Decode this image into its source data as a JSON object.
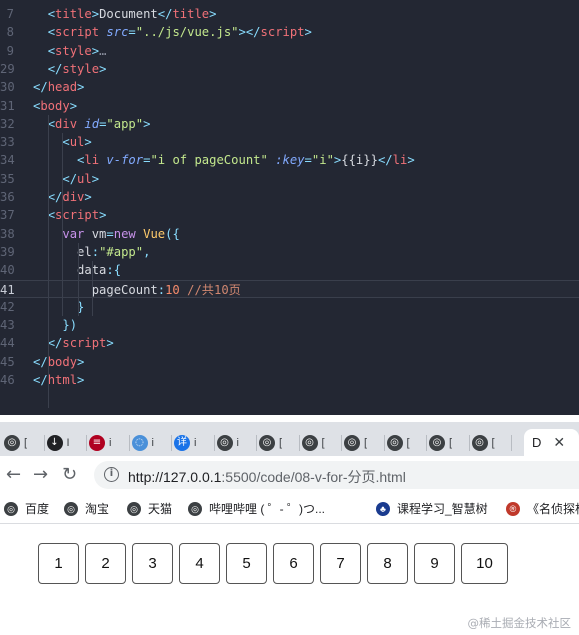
{
  "editor": {
    "lines": [
      {
        "num": "7",
        "html": "  <span class='p'>&lt;</span><span class='t'>title</span><span class='p'>&gt;</span><span class='w'>Document</span><span class='p'>&lt;/</span><span class='t'>title</span><span class='p'>&gt;</span>"
      },
      {
        "num": "8",
        "html": "  <span class='p'>&lt;</span><span class='t'>script</span> <span class='a'>src</span><span class='p'>=</span><span class='s'>\"../js/vue.js\"</span><span class='p'>&gt;&lt;/</span><span class='t'>script</span><span class='p'>&gt;</span>"
      },
      {
        "num": "9",
        "html": "  <span class='p'>&lt;</span><span class='t'>style</span><span class='p'>&gt;</span><span class='g'>…</span>"
      },
      {
        "num": "29",
        "html": "  <span class='p'>&lt;/</span><span class='t'>style</span><span class='p'>&gt;</span>"
      },
      {
        "num": "30",
        "html": "<span class='p'>&lt;/</span><span class='t'>head</span><span class='p'>&gt;</span>"
      },
      {
        "num": "31",
        "html": "<span class='p'>&lt;</span><span class='t'>body</span><span class='p'>&gt;</span>"
      },
      {
        "num": "32",
        "html": "  <span class='p'>&lt;</span><span class='t'>div</span> <span class='a'>id</span><span class='p'>=</span><span class='s'>\"app\"</span><span class='p'>&gt;</span>"
      },
      {
        "num": "33",
        "html": "    <span class='p'>&lt;</span><span class='t'>ul</span><span class='p'>&gt;</span>"
      },
      {
        "num": "34",
        "html": "      <span class='p'>&lt;</span><span class='t'>li</span> <span class='a'>v-for</span><span class='p'>=</span><span class='s'>\"i of pageCount\"</span> <span class='a'>:key</span><span class='p'>=</span><span class='s'>\"i\"</span><span class='p'>&gt;</span><span class='w'>{{i}}</span><span class='p'>&lt;/</span><span class='t'>li</span><span class='p'>&gt;</span>"
      },
      {
        "num": "35",
        "html": "    <span class='p'>&lt;/</span><span class='t'>ul</span><span class='p'>&gt;</span>"
      },
      {
        "num": "36",
        "html": "  <span class='p'>&lt;/</span><span class='t'>div</span><span class='p'>&gt;</span>"
      },
      {
        "num": "37",
        "html": "  <span class='p'>&lt;</span><span class='t'>script</span><span class='p'>&gt;</span>"
      },
      {
        "num": "38",
        "html": "    <span class='k'>var</span> <span class='w'>vm</span><span class='p'>=</span><span class='k'>new</span> <span class='y'>Vue</span><span class='p'>({</span>"
      },
      {
        "num": "39",
        "html": "      <span class='w'>el</span><span class='p'>:</span><span class='s'>\"#app\"</span><span class='p'>,</span>"
      },
      {
        "num": "40",
        "html": "      <span class='w'>data</span><span class='p'>:{</span>"
      },
      {
        "num": "41",
        "html": "        <span class='w'>pageCount</span><span class='p'>:</span><span class='n'>10</span> <span class='c'>//共10页</span>",
        "current": true
      },
      {
        "num": "42",
        "html": "      <span class='p'>}</span>"
      },
      {
        "num": "43",
        "html": "    <span class='p'>})</span>"
      },
      {
        "num": "44",
        "html": "  <span class='p'>&lt;/</span><span class='t'>script</span><span class='p'>&gt;</span>"
      },
      {
        "num": "45",
        "html": "<span class='p'>&lt;/</span><span class='t'>body</span><span class='p'>&gt;</span>"
      },
      {
        "num": "46",
        "html": "<span class='p'>&lt;/</span><span class='t'>html</span><span class='p'>&gt;</span>"
      }
    ]
  },
  "browser": {
    "tabs": [
      {
        "glyph": "◎",
        "label": "[",
        "color": "#3c4043"
      },
      {
        "glyph": "↓",
        "label": "I",
        "color": "#202124"
      },
      {
        "glyph": "≡",
        "label": "i",
        "color": "#b00020"
      },
      {
        "glyph": "◌",
        "label": "i",
        "color": "#4a90d9"
      },
      {
        "glyph": "详",
        "label": "i",
        "color": "#1a73e8"
      },
      {
        "glyph": "◎",
        "label": "i",
        "color": "#3c4043"
      },
      {
        "glyph": "◎",
        "label": "[",
        "color": "#3c4043"
      },
      {
        "glyph": "◎",
        "label": "[",
        "color": "#3c4043"
      },
      {
        "glyph": "◎",
        "label": "[",
        "color": "#3c4043"
      },
      {
        "glyph": "◎",
        "label": "[",
        "color": "#3c4043"
      },
      {
        "glyph": "◎",
        "label": "[",
        "color": "#3c4043"
      },
      {
        "glyph": "◎",
        "label": "[",
        "color": "#3c4043"
      }
    ],
    "active_tab": {
      "label": "D",
      "close": "✕"
    },
    "nav": {
      "back": "←",
      "forward": "→",
      "reload": "↻"
    },
    "url": {
      "host": "http://127.0.0.1",
      "path": ":5500/code/08-v-for-分页.html"
    },
    "bookmarks": [
      {
        "glyph": "◎",
        "label": "百度",
        "color": "#3c4043"
      },
      {
        "glyph": "◎",
        "label": "淘宝",
        "color": "#3c4043"
      },
      {
        "glyph": "◎",
        "label": "天猫",
        "color": "#3c4043"
      },
      {
        "glyph": "◎",
        "label": "哔哩哔哩 ( ゜- ゜)つ...",
        "color": "#3c4043"
      },
      {
        "glyph": "♣",
        "label": "课程学习_智慧树",
        "color": "#1a3b8f"
      },
      {
        "glyph": "®",
        "label": "《名侦探柯",
        "color": "#c0392b"
      }
    ]
  },
  "page": {
    "pages": [
      "1",
      "2",
      "3",
      "4",
      "5",
      "6",
      "7",
      "8",
      "9",
      "10"
    ]
  },
  "watermark": "@稀土掘金技术社区"
}
